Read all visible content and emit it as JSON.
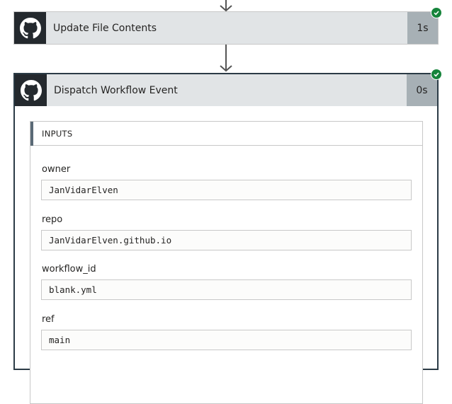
{
  "steps": [
    {
      "title": "Update File Contents",
      "duration": "1s",
      "status_icon": "success-check-icon",
      "logo_icon": "github-logo-icon"
    },
    {
      "title": "Dispatch Workflow Event",
      "duration": "0s",
      "status_icon": "success-check-icon",
      "logo_icon": "github-logo-icon"
    }
  ],
  "inputs": {
    "header": "INPUTS",
    "fields": [
      {
        "label": "owner",
        "value": "JanVidarElven"
      },
      {
        "label": "repo",
        "value": "JanVidarElven.github.io"
      },
      {
        "label": "workflow_id",
        "value": "blank.yml"
      },
      {
        "label": "ref",
        "value": "main"
      }
    ]
  },
  "colors": {
    "success": "#16843b",
    "card_header": "#e1e4e6",
    "duration_bg": "#a7b0b5",
    "logo_bg": "#24292e",
    "accent_bar": "#5a6a76",
    "selected_border": "#2b3b46"
  }
}
